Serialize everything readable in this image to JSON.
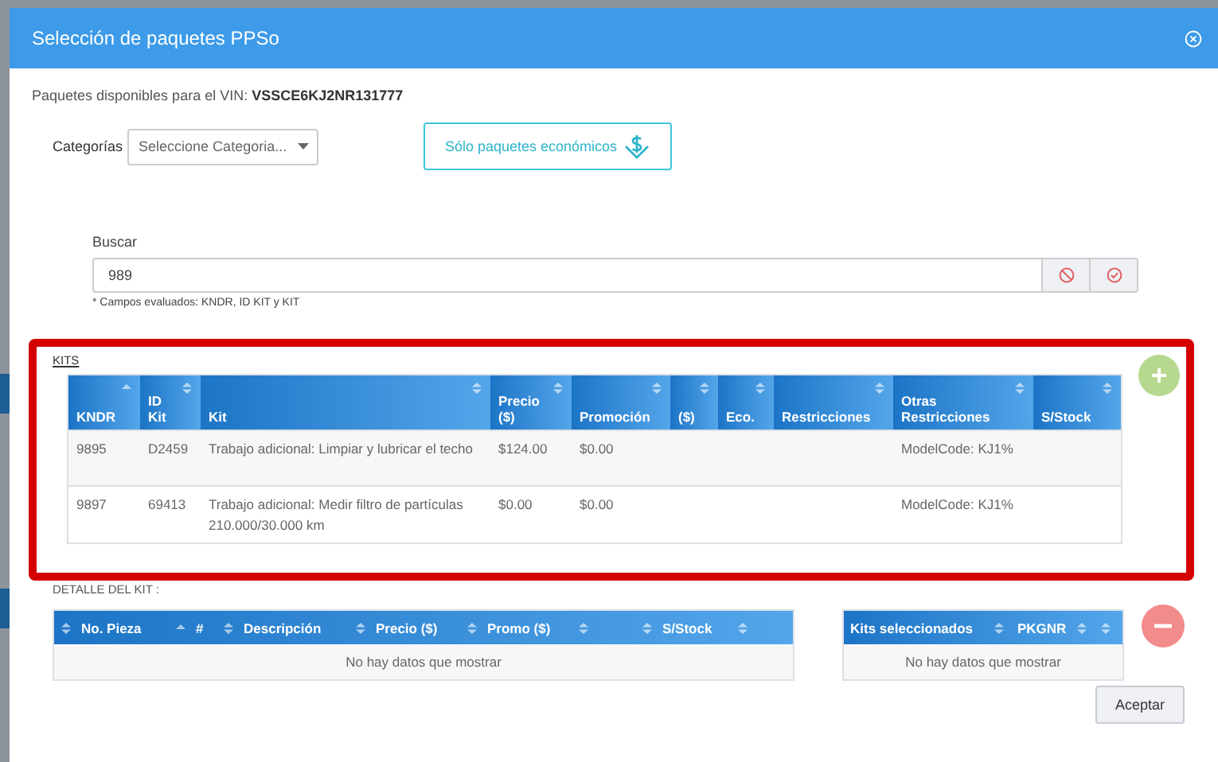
{
  "dialog": {
    "title": "Selección de paquetes PPSo"
  },
  "vin": {
    "label": "Paquetes disponibles para el VIN:",
    "value": "VSSCE6KJ2NR131777"
  },
  "categories": {
    "label": "Categorías",
    "placeholder": "Seleccione Categoria..."
  },
  "economy_button": {
    "label": "Sólo paquetes económicos"
  },
  "search": {
    "label": "Buscar",
    "value": "989",
    "hint": "* Campos evaluados: KNDR, ID KIT y KIT"
  },
  "kits": {
    "title": "KITS",
    "columns": [
      {
        "label": "KNDR",
        "sorted": true
      },
      {
        "label": "ID Kit",
        "sorted": false
      },
      {
        "label": "Kit",
        "sorted": false
      },
      {
        "label": "Precio ($)",
        "sorted": false
      },
      {
        "label": "Promoción",
        "sorted": false
      },
      {
        "label": "($)",
        "sorted": false
      },
      {
        "label": "Eco.",
        "sorted": false
      },
      {
        "label": "Restricciones",
        "sorted": false
      },
      {
        "label": "Otras Restricciones",
        "sorted": false
      },
      {
        "label": "S/Stock",
        "sorted": false
      }
    ],
    "rows": [
      [
        "9895",
        "D2459",
        "Trabajo adicional: Limpiar y lubricar el techo",
        "$124.00",
        "$0.00",
        null,
        null,
        null,
        "ModelCode: KJ1%",
        null
      ],
      [
        "9897",
        "69413",
        "Trabajo adicional: Medir filtro de partículas 210.000/30.000 km",
        "$0.00",
        "$0.00",
        null,
        null,
        null,
        "ModelCode: KJ1%",
        null
      ]
    ]
  },
  "detail": {
    "title": "DETALLE DEL KIT :",
    "columns": [
      {
        "label": "No. Pieza",
        "sorted": false
      },
      {
        "label": "#",
        "sorted": true
      },
      {
        "label": "Descripción",
        "sorted": false
      },
      {
        "label": "Precio ($)",
        "sorted": false
      },
      {
        "label": "Promo ($)",
        "sorted": false
      },
      {
        "sorted": false
      },
      {
        "label": "S/Stock",
        "sorted": false
      },
      {
        "sorted": false
      }
    ],
    "empty_message": "No hay datos que mostrar"
  },
  "selected_kits": {
    "columns": [
      {
        "label": "Kits seleccionados",
        "sorted": false
      },
      {
        "label": "PKGNR",
        "sorted": false
      },
      {
        "sorted": false
      }
    ],
    "empty_message": "No hay datos que mostrar"
  },
  "accept_button": {
    "label": "Aceptar"
  }
}
